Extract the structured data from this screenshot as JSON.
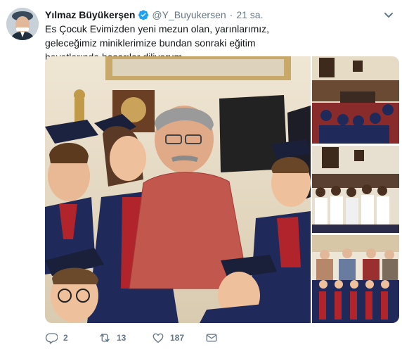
{
  "tweet": {
    "author_name": "Yılmaz Büyükerşen",
    "handle": "@Y_Buyukersen",
    "separator": "·",
    "time": "21 sa.",
    "text": "Es Çocuk Evimizden yeni mezun olan, yarınlarımız, geleceğimiz miniklerimize bundan sonraki eğitim hayatlarında başarılar diliyorum."
  },
  "icons": {
    "verified": "verified-badge-icon",
    "caret": "chevron-down-icon",
    "reply": "reply-icon",
    "retweet": "retweet-icon",
    "like": "heart-icon",
    "message": "envelope-icon"
  },
  "actions": {
    "reply_count": "2",
    "retweet_count": "13",
    "like_count": "187"
  },
  "colors": {
    "brand_blue": "#1da1f2",
    "text": "#14171a",
    "secondary": "#657786"
  }
}
